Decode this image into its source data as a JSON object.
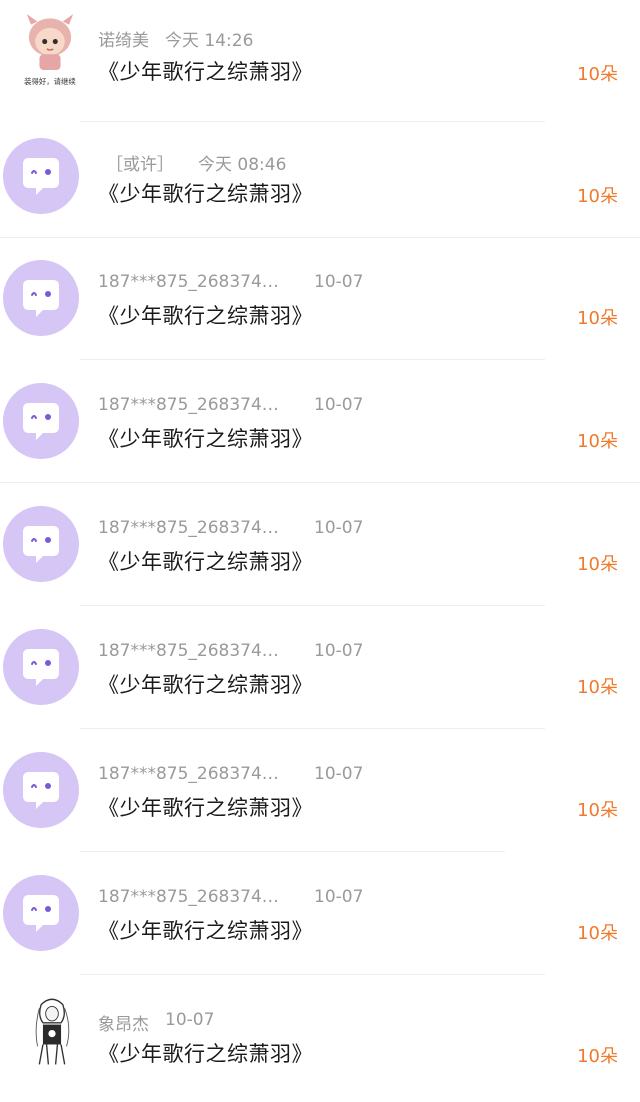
{
  "gift_list": {
    "items": [
      {
        "name": "诺绮美",
        "time": "今天 14:26",
        "title": "《少年歌行之综萧羽》",
        "count": "10朵",
        "avatar": "doll",
        "avatar_caption": "装得好，请继续"
      },
      {
        "name": "［或许］",
        "time": "今天 08:46",
        "title": "《少年歌行之综萧羽》",
        "count": "10朵",
        "avatar": "chat-bubble"
      },
      {
        "name": "187***875_268374…",
        "time": "10-07",
        "title": "《少年歌行之综萧羽》",
        "count": "10朵",
        "avatar": "chat-bubble"
      },
      {
        "name": "187***875_268374…",
        "time": "10-07",
        "title": "《少年歌行之综萧羽》",
        "count": "10朵",
        "avatar": "chat-bubble"
      },
      {
        "name": "187***875_268374…",
        "time": "10-07",
        "title": "《少年歌行之综萧羽》",
        "count": "10朵",
        "avatar": "chat-bubble"
      },
      {
        "name": "187***875_268374…",
        "time": "10-07",
        "title": "《少年歌行之综萧羽》",
        "count": "10朵",
        "avatar": "chat-bubble"
      },
      {
        "name": "187***875_268374…",
        "time": "10-07",
        "title": "《少年歌行之综萧羽》",
        "count": "10朵",
        "avatar": "chat-bubble"
      },
      {
        "name": "187***875_268374…",
        "time": "10-07",
        "title": "《少年歌行之综萧羽》",
        "count": "10朵",
        "avatar": "chat-bubble"
      },
      {
        "name": "象昂杰",
        "time": "10-07",
        "title": "《少年歌行之综萧羽》",
        "count": "10朵",
        "avatar": "sketch-figure"
      }
    ]
  },
  "colors": {
    "count": "#f07a2c",
    "meta": "#9a9a9a",
    "bubble_bg": "#d5c6f5",
    "divider": "#eeeeee"
  }
}
